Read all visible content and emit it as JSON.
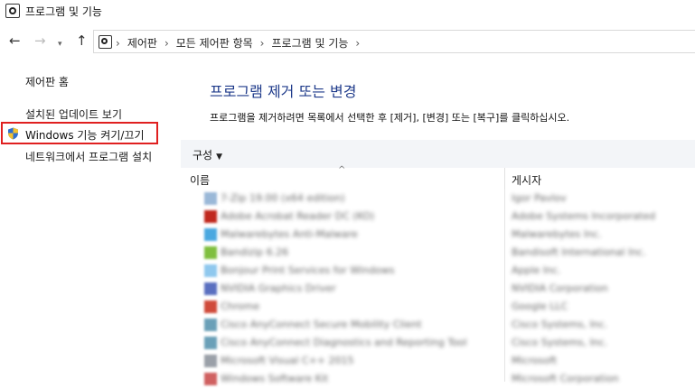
{
  "window": {
    "title": "프로그램 및 기능"
  },
  "address": {
    "breadcrumbs": [
      "제어판",
      "모든 제어판 항목",
      "프로그램 및 기능"
    ]
  },
  "sidebar": {
    "links": [
      {
        "label": "제어판 홈"
      },
      {
        "label": "설치된 업데이트 보기"
      },
      {
        "label": "Windows 기능 켜기/끄기"
      },
      {
        "label": "네트워크에서 프로그램 설치"
      }
    ]
  },
  "main": {
    "title": "프로그램 제거 또는 변경",
    "description": "프로그램을 제거하려면 목록에서 선택한 후 [제거], [변경] 또는 [복구]를 클릭하십시오.",
    "organize_label": "구성"
  },
  "table": {
    "columns": [
      "이름",
      "게시자"
    ],
    "rows": [
      {
        "name": "7-Zip 19.00 (x64 edition)",
        "publisher": "Igor Pavlov",
        "icon_color": "#9ab8d8"
      },
      {
        "name": "Adobe Acrobat Reader DC (KO)",
        "publisher": "Adobe Systems Incorporated",
        "icon_color": "#c0281e"
      },
      {
        "name": "Malwarebytes Anti-Malware",
        "publisher": "Malwarebytes Inc.",
        "icon_color": "#4aa8e0"
      },
      {
        "name": "Bandizip 6.26",
        "publisher": "Bandisoft International Inc.",
        "icon_color": "#7fbf3f"
      },
      {
        "name": "Bonjour Print Services for Windows",
        "publisher": "Apple Inc.",
        "icon_color": "#8fc8ee"
      },
      {
        "name": "NVIDIA Graphics Driver",
        "publisher": "NVIDIA Corporation",
        "icon_color": "#5a6fc0"
      },
      {
        "name": "Chrome",
        "publisher": "Google LLC",
        "icon_color": "#d04a3a"
      },
      {
        "name": "Cisco AnyConnect Secure Mobility Client",
        "publisher": "Cisco Systems, Inc.",
        "icon_color": "#6aa0b8"
      },
      {
        "name": "Cisco AnyConnect Diagnostics and Reporting Tool",
        "publisher": "Cisco Systems, Inc.",
        "icon_color": "#6aa0b8"
      },
      {
        "name": "Microsoft Visual C++ 2015",
        "publisher": "Microsoft",
        "icon_color": "#9aa0a8"
      },
      {
        "name": "Windows Software Kit",
        "publisher": "Microsoft Corporation",
        "icon_color": "#d06060"
      }
    ]
  },
  "colors": {
    "title_blue": "#1e3a8a",
    "highlight_red": "#e02020",
    "toolbar_bg": "#f3f5f8"
  }
}
